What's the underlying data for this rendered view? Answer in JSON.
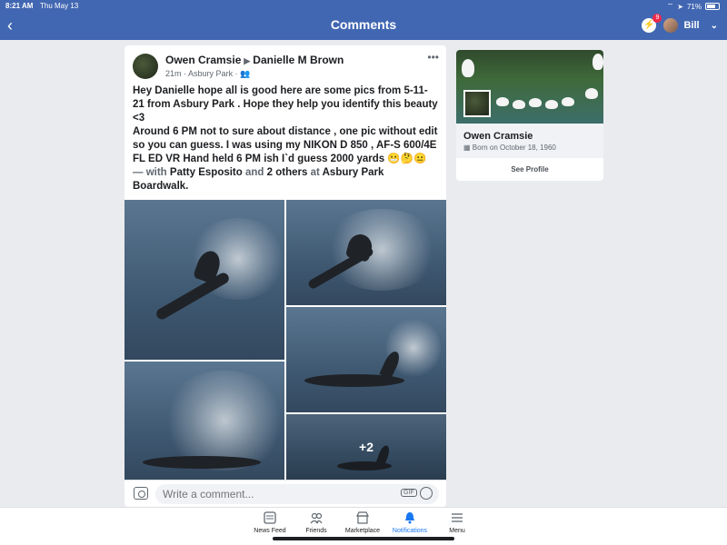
{
  "status": {
    "time": "8:21 AM",
    "date": "Thu May 13",
    "battery": "71%",
    "battery_level": 0.71
  },
  "nav": {
    "title": "Comments",
    "back_icon": "back-chevron-icon",
    "user_name": "Bill",
    "messenger_badge": "9"
  },
  "post": {
    "author": "Owen Cramsie",
    "target": "Danielle M Brown",
    "time": "21m",
    "location": "Asbury Park",
    "text_main": "Hey Danielle hope all is good here are some pics from 5-11-21 from Asbury Park . Hope they help you identify this beauty <3",
    "text_details": "Around 6 PM not to sure about distance , one pic without edit so you can guess.  I was using my NIKON D 850 , AF-S 600/4E FL ED VR Hand held 6 PM ish I`d guess 2000 yards",
    "emojis": "😬🤔😐",
    "with_prefix": "— with",
    "tagged_person": "Patty Esposito",
    "and_text": "and",
    "others": "2 others",
    "at_text": "at",
    "place": "Asbury Park Boardwalk",
    "period": ".",
    "more_photos": "+2"
  },
  "comment": {
    "placeholder": "Write a comment..."
  },
  "profile_card": {
    "name": "Owen Cramsie",
    "born": "Born on October 18, 1960",
    "see_profile": "See Profile"
  },
  "tabs": [
    {
      "label": "News Feed",
      "icon": "news-feed-icon"
    },
    {
      "label": "Friends",
      "icon": "friends-icon"
    },
    {
      "label": "Marketplace",
      "icon": "marketplace-icon"
    },
    {
      "label": "Notifications",
      "icon": "bell-icon",
      "active": true
    },
    {
      "label": "Menu",
      "icon": "menu-icon"
    }
  ],
  "colors": {
    "brand": "#4267b2",
    "active_tab": "#1877f2",
    "background": "#e9ebee"
  }
}
